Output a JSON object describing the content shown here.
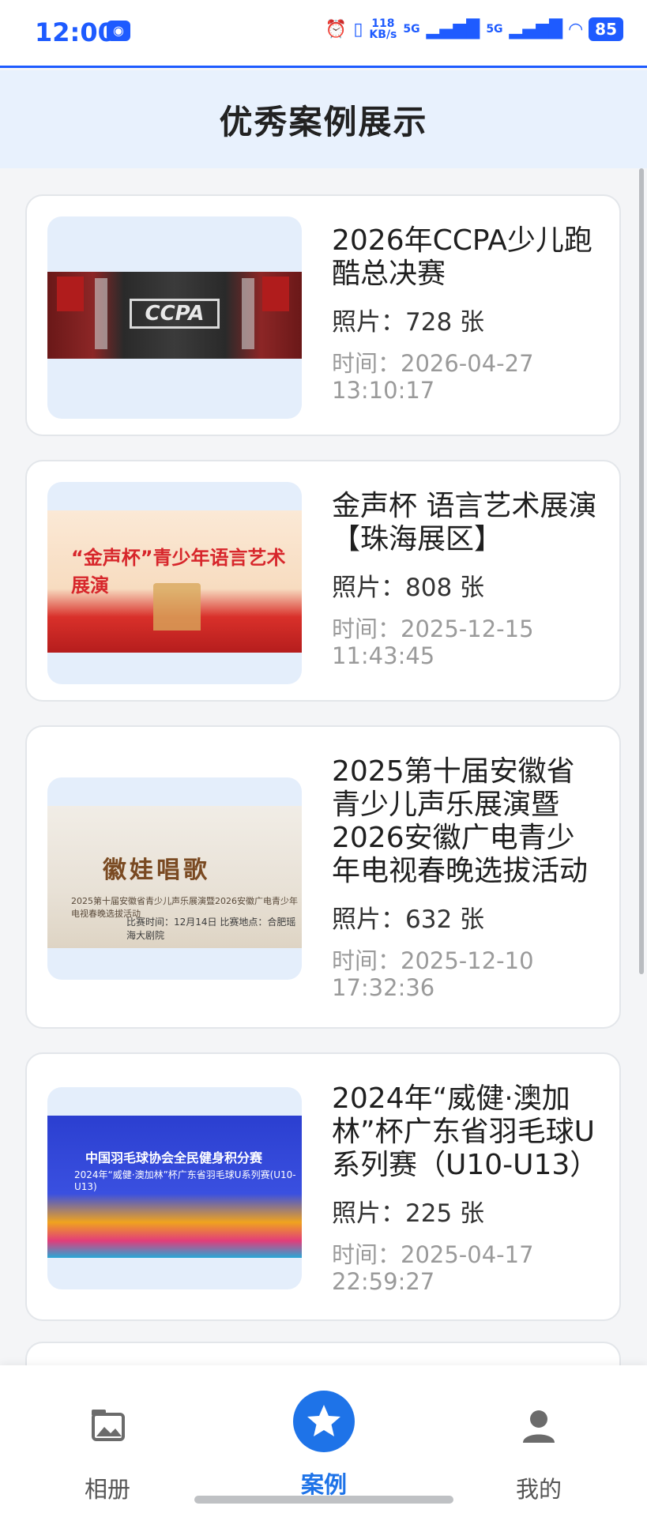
{
  "status": {
    "time": "12:00",
    "net_speed_value": "118",
    "net_speed_unit": "KB/s",
    "net_a": "5G",
    "net_b": "5G",
    "battery": "85"
  },
  "header": {
    "title": "优秀案例展示"
  },
  "cases": [
    {
      "title": "2026年CCPA少儿跑酷总决赛",
      "photos": "照片：728 张",
      "time_label": "时间：2026-04-27 13:10:17",
      "image_text": "CCPA"
    },
    {
      "title": "金声杯 语言艺术展演【珠海展区】",
      "photos": "照片：808 张",
      "time_label": "时间：2025-12-15 11:43:45",
      "image_text": "“金声杯”青少年语言艺术展演"
    },
    {
      "title": "2025第十届安徽省青少儿声乐展演暨2026安徽广电青少年电视春晚选拔活动",
      "photos": "照片：632 张",
      "time_label": "时间：2025-12-10 17:32:36",
      "image_text": "徽娃唱歌",
      "image_sub": "2025第十届安徽省青少儿声乐展演暨2026安徽广电青少年电视春晚选拔活动",
      "image_sub2": "比赛时间：12月14日  比赛地点：合肥瑶海大剧院"
    },
    {
      "title": "2024年“威健·澳加林”杯广东省羽毛球U系列赛（U10-U13）",
      "photos": "照片：225 张",
      "time_label": "时间：2025-04-17 22:59:27",
      "image_text": "中国羽毛球协会全民健身积分赛",
      "image_sub": "2024年“威健·澳加林”杯广东省羽毛球U系列赛(U10-U13)"
    }
  ],
  "tabs": [
    {
      "label": "相册",
      "icon": "album-icon",
      "active": false
    },
    {
      "label": "案例",
      "icon": "star-icon",
      "active": true
    },
    {
      "label": "我的",
      "icon": "user-icon",
      "active": false
    }
  ],
  "colors": {
    "accent": "#1e73e8",
    "header_bg": "#e8f1fd",
    "muted": "#9a9a9a"
  }
}
